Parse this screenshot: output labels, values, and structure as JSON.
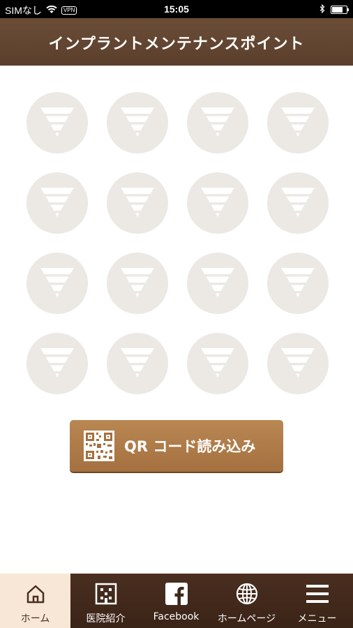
{
  "status_bar": {
    "carrier": "SIMなし",
    "vpn": "VPN",
    "time": "15:05"
  },
  "header": {
    "title": "インプラントメンテナンスポイント"
  },
  "points": {
    "rows": 4,
    "columns": 4,
    "icon": "layered-funnel-icon",
    "color": "#ece8e3"
  },
  "qr_button": {
    "label": "QR コード読み込み",
    "icon": "qr-code-icon"
  },
  "tabs": [
    {
      "label": "ホーム",
      "icon": "home-icon",
      "active": true
    },
    {
      "label": "医院紹介",
      "icon": "clinic-icon",
      "active": false
    },
    {
      "label": "Facebook",
      "icon": "facebook-icon",
      "active": false
    },
    {
      "label": "ホームページ",
      "icon": "globe-icon",
      "active": false
    },
    {
      "label": "メニュー",
      "icon": "menu-icon",
      "active": false
    }
  ],
  "colors": {
    "header": "#5f432f",
    "tabbar": "#3f271a",
    "button": "#b07a48",
    "active_tab": "#f8e7d6"
  }
}
